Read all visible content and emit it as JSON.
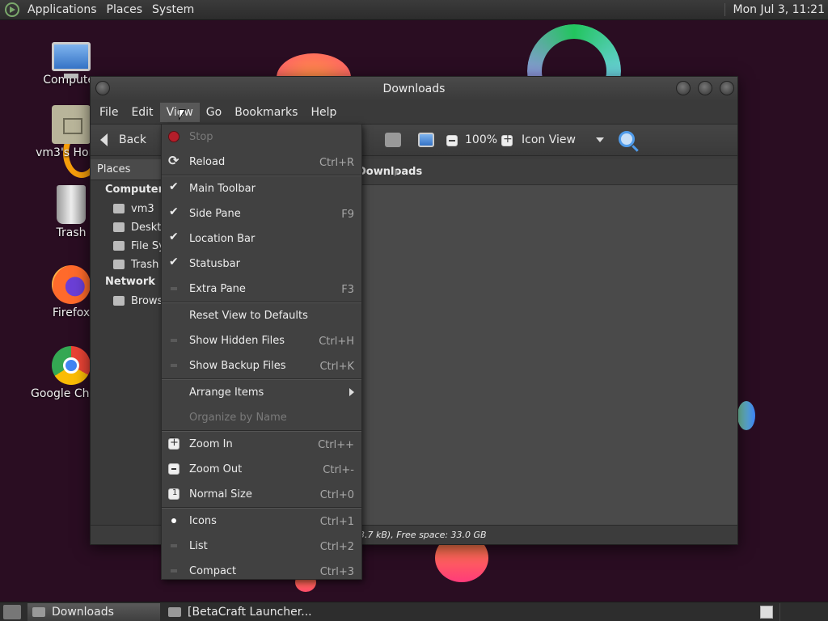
{
  "top_panel": {
    "menus": [
      "Applications",
      "Places",
      "System"
    ],
    "clock": "Mon Jul 3, 11:21"
  },
  "desktop": {
    "icons": [
      {
        "label": "Computer",
        "icon": "computer-icon"
      },
      {
        "label": "vm3's Home",
        "icon": "home-folder-icon"
      },
      {
        "label": "Trash",
        "icon": "trash-icon"
      },
      {
        "label": "Firefox",
        "icon": "firefox-icon"
      },
      {
        "label": "Google Chrome",
        "icon": "chrome-icon"
      }
    ]
  },
  "window": {
    "title": "Downloads",
    "menubar": [
      "File",
      "Edit",
      "View",
      "Go",
      "Bookmarks",
      "Help"
    ],
    "toolbar": {
      "back_label": "Back",
      "zoom_level": "100%",
      "view_mode": "Icon View"
    },
    "sidebar": {
      "header": "Places",
      "computer_section": "Computer",
      "computer_items": [
        "vm3",
        "Desktop",
        "File System",
        "Trash"
      ],
      "network_section": "Network",
      "network_items": [
        "Browse Network"
      ]
    },
    "location_crumb": "Downloads",
    "statusbar": "3.7 kB), Free space: 33.0 GB"
  },
  "view_menu": {
    "items": [
      {
        "label": "Stop",
        "accel": "",
        "marker": "stop",
        "disabled": true
      },
      {
        "label": "Reload",
        "accel": "Ctrl+R",
        "marker": "reload"
      },
      {
        "label": "Main Toolbar",
        "accel": "",
        "marker": "check"
      },
      {
        "label": "Side Pane",
        "accel": "F9",
        "marker": "check"
      },
      {
        "label": "Location Bar",
        "accel": "",
        "marker": "check"
      },
      {
        "label": "Statusbar",
        "accel": "",
        "marker": "check"
      },
      {
        "label": "Extra Pane",
        "accel": "F3",
        "marker": "dim"
      },
      {
        "label": "Reset View to Defaults",
        "accel": "",
        "marker": "none"
      },
      {
        "label": "Show Hidden Files",
        "accel": "Ctrl+H",
        "marker": "dim"
      },
      {
        "label": "Show Backup Files",
        "accel": "Ctrl+K",
        "marker": "dim"
      },
      {
        "label": "Arrange Items",
        "accel": "",
        "marker": "none",
        "submenu": true
      },
      {
        "label": "Organize by Name",
        "accel": "",
        "marker": "none",
        "disabled": true
      },
      {
        "label": "Zoom In",
        "accel": "Ctrl++",
        "marker": "plus"
      },
      {
        "label": "Zoom Out",
        "accel": "Ctrl+-",
        "marker": "minus"
      },
      {
        "label": "Normal Size",
        "accel": "Ctrl+0",
        "marker": "one"
      },
      {
        "label": "Icons",
        "accel": "Ctrl+1",
        "marker": "dot"
      },
      {
        "label": "List",
        "accel": "Ctrl+2",
        "marker": "dim"
      },
      {
        "label": "Compact",
        "accel": "Ctrl+3",
        "marker": "dim"
      }
    ]
  },
  "taskbar": {
    "tasks": [
      "Downloads",
      "[BetaCraft Launcher..."
    ]
  }
}
